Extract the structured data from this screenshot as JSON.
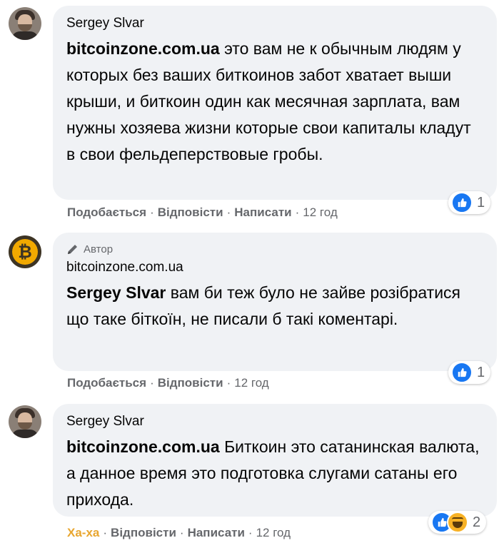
{
  "comments": [
    {
      "author": "Sergey Slvar",
      "mention": "bitcoinzone.com.ua",
      "text": " это вам не к обычным людям у которых без ваших биткоинов забот хватает выши крыши, и биткоин один как месячная зарплата, вам нужны хозяева жизни которые свои капиталы кладут в свои фельдеперствовые гробы.",
      "actions": {
        "like": "Подобається",
        "reply": "Відповісти",
        "write": "Написати",
        "time": "12 год"
      },
      "reactions": {
        "count": "1",
        "types": [
          "like-icon"
        ]
      }
    },
    {
      "author_badge": "Автор",
      "author": "bitcoinzone.com.ua",
      "mention": "Sergey Slvar",
      "text": " вам би теж було не зайве розібратися що таке біткоїн, не писали б такі коментарі.",
      "actions": {
        "like": "Подобається",
        "reply": "Відповісти",
        "time": "12 год"
      },
      "reactions": {
        "count": "1",
        "types": [
          "like-icon"
        ]
      }
    },
    {
      "author": "Sergey Slvar",
      "mention": "bitcoinzone.com.ua",
      "text": " Биткоин это сатанинская валюта, а данное время это подготовка слугами сатаны его прихода.",
      "actions": {
        "reaction": "Ха-ха",
        "reply": "Відповісти",
        "write": "Написати",
        "time": "12 год"
      },
      "reactions": {
        "count": "2",
        "types": [
          "like-icon",
          "haha-icon"
        ]
      }
    }
  ],
  "colors": {
    "bubble": "#f0f2f5",
    "like": "#1877f2",
    "haha": "#e8a62f",
    "meta": "#65676b"
  },
  "separator": "·",
  "avatar_glyph": "₿"
}
